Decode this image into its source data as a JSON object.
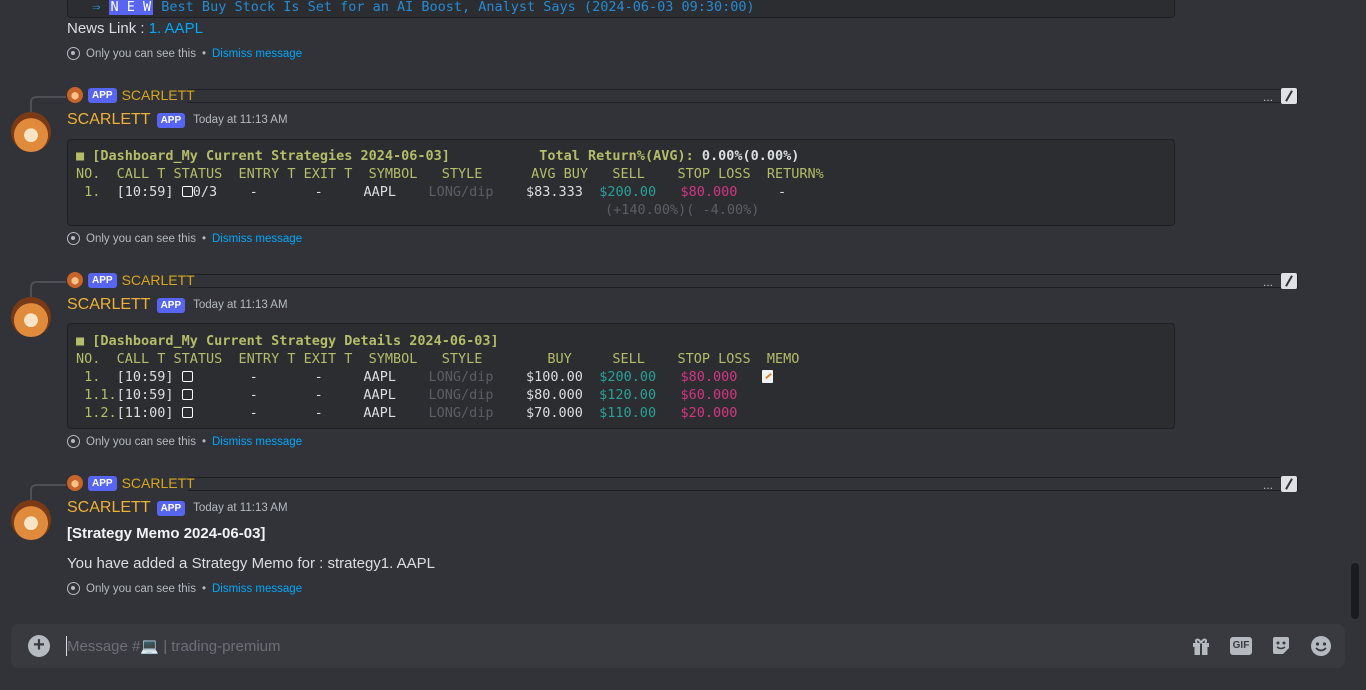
{
  "top": {
    "news_tag": "N E W",
    "news_headline": "Best Buy Stock Is Set for an AI Boost, Analyst Says (2024-06-03 09:30:00)",
    "news_link_label": "News Link : ",
    "news_link_text": "1. AAPL",
    "ephemeral": "Only you can see this",
    "dismiss": "Dismiss message"
  },
  "bot": {
    "name": "SCARLETT",
    "badge": "APP",
    "timestamp": "Today at 11:13 AM",
    "more": "..."
  },
  "msg1": {
    "title": "■ [Dashboard_My Current Strategies 2024-06-03]",
    "total_label": "Total Return%(AVG):",
    "total_value": "0.00%(0.00%)",
    "header": "NO.  CALL T STATUS  ENTRY T EXIT T  SYMBOL   STYLE      AVG BUY   SELL    STOP LOSS  RETURN%",
    "row": {
      "no": " 1.",
      "call": "[10:59]",
      "status": "0/3",
      "entry": "-",
      "exit": "-",
      "symbol": "AAPL",
      "style": "LONG/dip",
      "avg_buy": "$83.333",
      "sell": "$200.00",
      "stop": "$80.000",
      "ret": "-"
    },
    "sub": "(+140.00%)( -4.00%)"
  },
  "msg2": {
    "title": "■ [Dashboard_My Current Strategy Details 2024-06-03]",
    "header": "NO.  CALL T STATUS  ENTRY T EXIT T  SYMBOL   STYLE        BUY     SELL    STOP LOSS  MEMO",
    "rows": [
      {
        "no": " 1.",
        "call": "[10:59]",
        "entry": "-",
        "exit": "-",
        "symbol": "AAPL",
        "style": "LONG/dip",
        "buy": "$100.00",
        "sell": "$200.00",
        "stop": "$80.000"
      },
      {
        "no": " 1.1.",
        "call": "[10:59]",
        "entry": "-",
        "exit": "-",
        "symbol": "AAPL",
        "style": "LONG/dip",
        "buy": "$80.000",
        "sell": "$120.00",
        "stop": "$60.000"
      },
      {
        "no": " 1.2.",
        "call": "[11:00]",
        "entry": "-",
        "exit": "-",
        "symbol": "AAPL",
        "style": "LONG/dip",
        "buy": "$70.000",
        "sell": "$110.00",
        "stop": "$20.000"
      }
    ]
  },
  "msg3": {
    "title": "[Strategy Memo 2024-06-03]",
    "body": "You have added a Strategy Memo for : strategy1. AAPL"
  },
  "composer": {
    "placeholder": "Message #💻 | trading-premium",
    "gif": "GIF"
  },
  "colors": {
    "background": "#313338",
    "code_bg": "#2b2d31",
    "accent": "#5865f2",
    "username": "#f0b132",
    "link": "#00a8fc",
    "olive": "#b5bd68",
    "cyan": "#2aa198",
    "magenta": "#d33682"
  }
}
